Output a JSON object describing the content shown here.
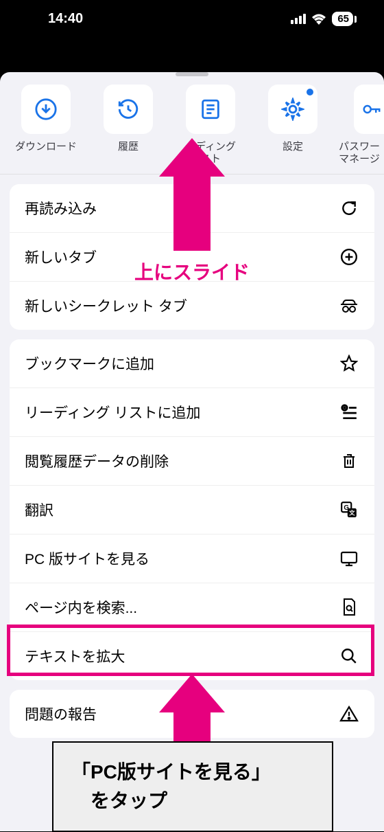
{
  "status": {
    "time": "14:40",
    "battery": "65"
  },
  "shortcuts": [
    {
      "label": "ダウンロード",
      "icon": "download"
    },
    {
      "label": "履歴",
      "icon": "history"
    },
    {
      "label": "ーディング\nスト",
      "icon": "reading"
    },
    {
      "label": "設定",
      "icon": "settings",
      "dot": true
    },
    {
      "label": "パスワー\nマネージ",
      "icon": "key"
    }
  ],
  "section1": [
    {
      "label": "再読み込み",
      "icon": "reload"
    },
    {
      "label": "新しいタブ",
      "icon": "plus-circle"
    },
    {
      "label": "新しいシークレット タブ",
      "icon": "incognito"
    }
  ],
  "section2": [
    {
      "label": "ブックマークに追加",
      "icon": "star"
    },
    {
      "label": "リーディング リストに追加",
      "icon": "add-list"
    },
    {
      "label": "閲覧履歴データの削除",
      "icon": "trash"
    },
    {
      "label": "翻訳",
      "icon": "translate"
    },
    {
      "label": "PC 版サイトを見る",
      "icon": "desktop"
    },
    {
      "label": "ページ内を検索...",
      "icon": "find"
    },
    {
      "label": "テキストを拡大",
      "icon": "zoom"
    }
  ],
  "section3": [
    {
      "label": "問題の報告",
      "icon": "warning"
    }
  ],
  "annotations": {
    "slide": "上にスライド",
    "callout_line1": "「PC版サイトを見る」",
    "callout_line2": "　をタップ"
  }
}
